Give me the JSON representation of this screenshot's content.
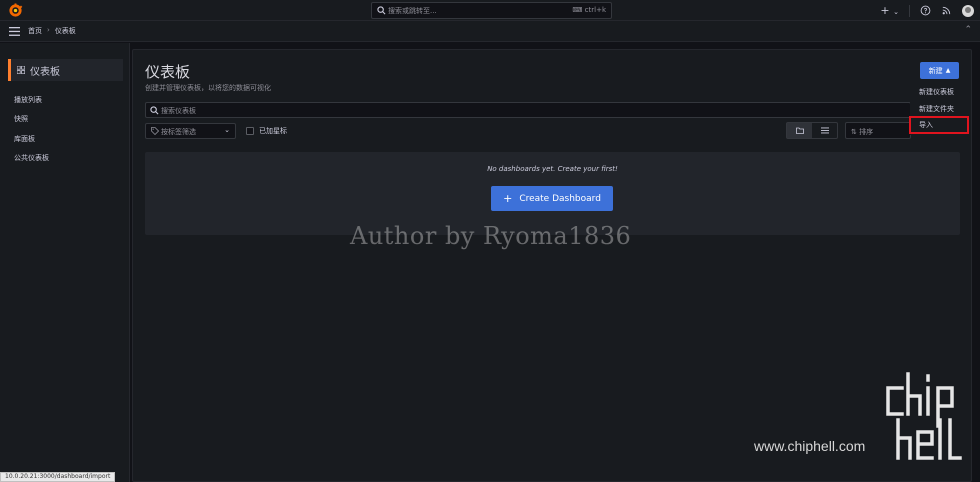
{
  "topbar": {
    "search_placeholder": "搜索或跳转至...",
    "search_shortcut": "ctrl+k",
    "add_label": "+",
    "add_chevron": "⌄"
  },
  "breadcrumb": {
    "home": "首页",
    "separator": "›",
    "current": "仪表板"
  },
  "sidebar": {
    "section_title": "仪表板",
    "items": [
      {
        "label": "播放列表"
      },
      {
        "label": "快照"
      },
      {
        "label": "库面板"
      },
      {
        "label": "公共仪表板"
      }
    ]
  },
  "main": {
    "title": "仪表板",
    "subtitle": "创建并管理仪表板，以将您的数据可视化",
    "new_button": "新建",
    "search_placeholder": "搜索仪表板",
    "tag_filter_placeholder": "按标签筛选",
    "starred_label": "已加星标",
    "sort_placeholder": "排序",
    "empty_message": "No dashboards yet. Create your first!",
    "create_button": "Create Dashboard"
  },
  "new_menu": {
    "items": [
      {
        "label": "新建仪表板"
      },
      {
        "label": "新建文件夹"
      },
      {
        "label": "导入"
      }
    ],
    "highlighted_item": "导入"
  },
  "overlays": {
    "author_watermark": "Author by Ryoma1836",
    "site_watermark": "www.chiphell.com"
  },
  "status_url": "10.0.20.21:3000/dashboard/import",
  "colors": {
    "accent_orange": "#ff7f2e",
    "primary_blue": "#3d71d9",
    "highlight_red": "#e0141e"
  }
}
